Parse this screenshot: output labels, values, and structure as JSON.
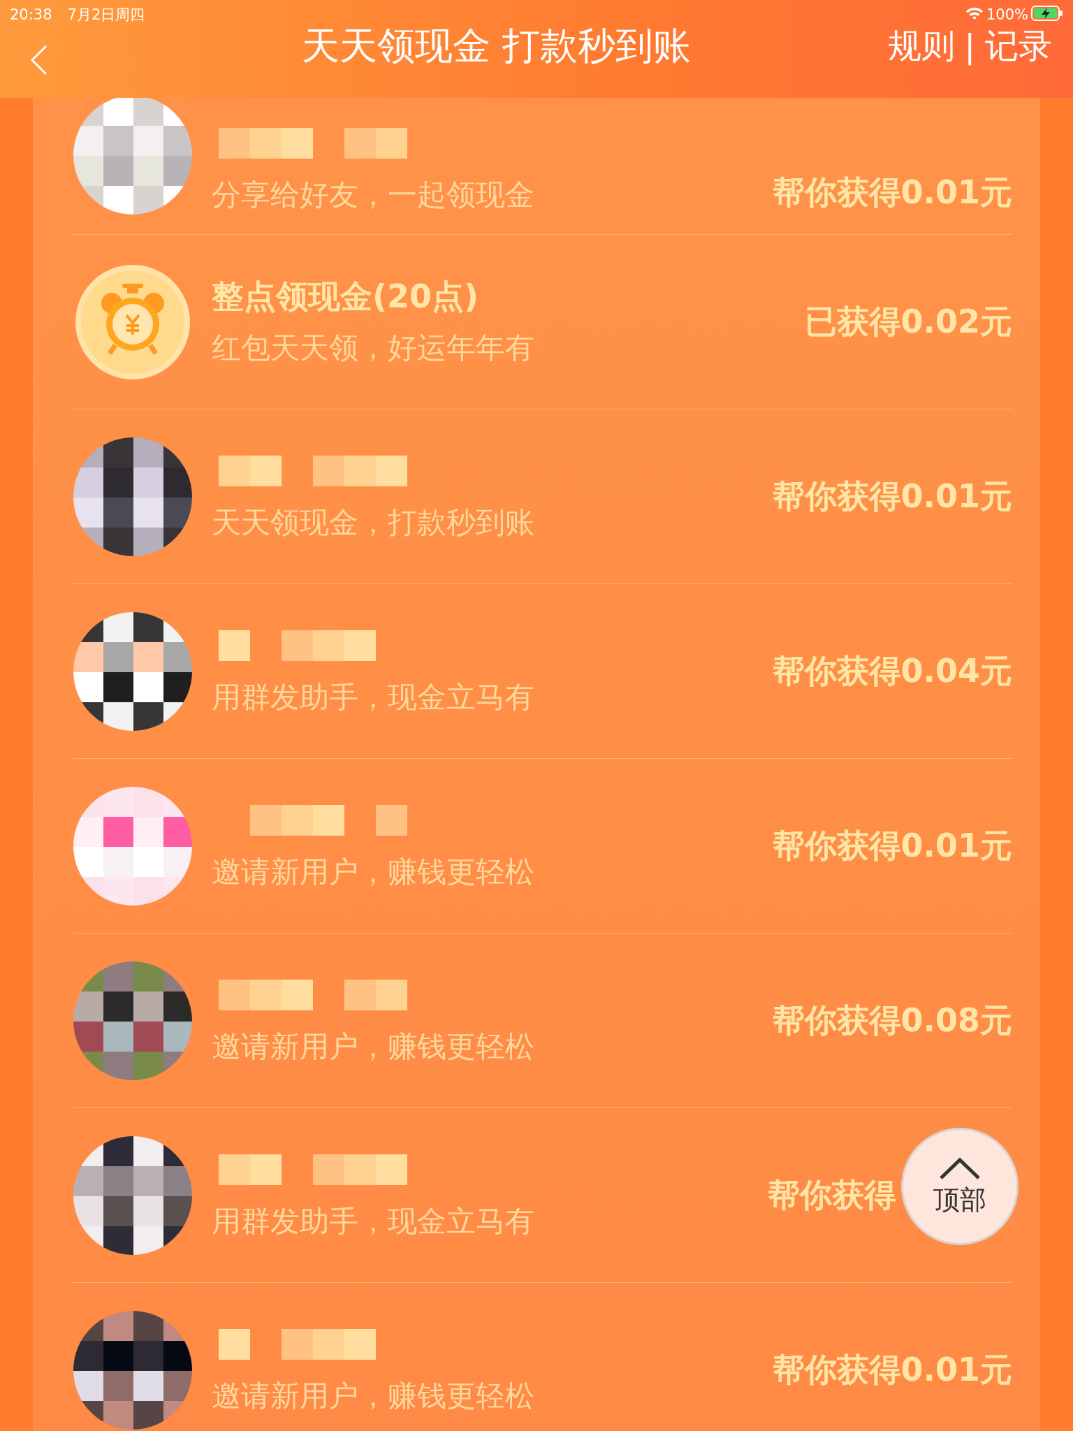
{
  "status_bar": {
    "time": "20:38",
    "date": "7月2日周四",
    "battery": "100%"
  },
  "nav": {
    "title": "天天领现金 打款秒到账",
    "links": [
      {
        "label": "规则"
      },
      {
        "label": "记录"
      }
    ],
    "separator": "|"
  },
  "rows": [
    {
      "kind": "friend",
      "subtitle": "分享给好友，一起领现金",
      "reward": "帮你获得0.01元"
    },
    {
      "kind": "task",
      "title": "整点领现金(20点)",
      "subtitle": "红包天天领，好运年年有",
      "reward": "已获得0.02元"
    },
    {
      "kind": "friend",
      "subtitle": "天天领现金，打款秒到账",
      "reward": "帮你获得0.01元"
    },
    {
      "kind": "friend",
      "subtitle": "用群发助手，现金立马有",
      "reward": "帮你获得0.04元"
    },
    {
      "kind": "friend",
      "subtitle": "邀请新用户，赚钱更轻松",
      "reward": "帮你获得0.01元"
    },
    {
      "kind": "friend",
      "subtitle": "邀请新用户，赚钱更轻松",
      "reward": "帮你获得0.08元"
    },
    {
      "kind": "friend",
      "subtitle": "用群发助手，现金立马有",
      "reward": "帮你获得",
      "covered": true
    },
    {
      "kind": "friend",
      "subtitle": "邀请新用户，赚钱更轻松",
      "reward": "帮你获得0.01元"
    }
  ],
  "back_to_top": {
    "label": "顶部"
  }
}
